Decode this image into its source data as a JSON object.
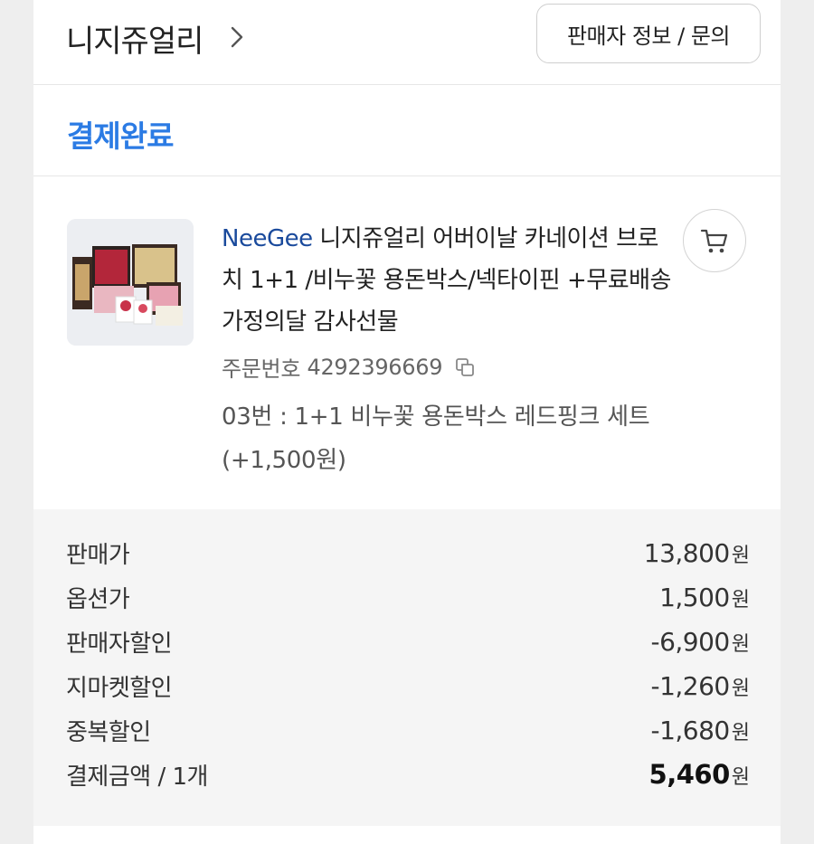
{
  "seller": {
    "name": "니지쥬얼리",
    "info_button": "판매자 정보 / 문의"
  },
  "order_status": "결제완료",
  "product": {
    "brand": "NeeGee",
    "title": " 니지쥬얼리 어버이날 카네이션 브로치 1+1 /비누꽃 용돈박스/넥타이핀 +무료배송 가정의달 감사선물",
    "order_number_label": "주문번호",
    "order_number": "4292396669",
    "option_text": "03번 : 1+1 비누꽃 용돈박스 레드핑크 세트 (+1,500원)",
    "icons": {
      "cart": "cart-icon",
      "copy": "copy-icon",
      "chevron": "chevron-right-icon"
    }
  },
  "summary": {
    "unit": "원",
    "rows": [
      {
        "label": "판매가",
        "value": "13,800"
      },
      {
        "label": "옵션가",
        "value": "1,500"
      },
      {
        "label": "판매자할인",
        "value": "-6,900"
      },
      {
        "label": "지마켓할인",
        "value": "-1,260"
      },
      {
        "label": "중복할인",
        "value": "-1,680"
      }
    ],
    "total": {
      "label": "결제금액 / 1개",
      "value": "5,460"
    }
  },
  "colors": {
    "status": "#2b7be4",
    "brand": "#1a4a9c",
    "summary_bg": "#f5f5f5"
  }
}
